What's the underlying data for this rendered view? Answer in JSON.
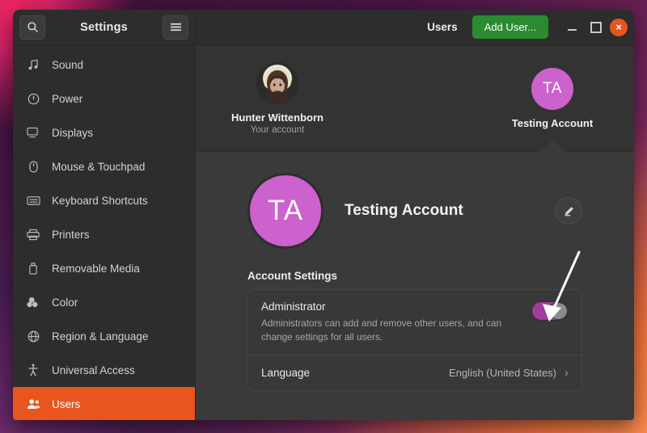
{
  "window": {
    "title": "Settings",
    "page_title": "Users",
    "add_user_label": "Add User...",
    "search_icon": "search-icon",
    "menu_icon": "hamburger-menu-icon",
    "minimize_label": "",
    "maximize_label": "",
    "close_label": "×",
    "accent_orange": "#e8551e",
    "accent_green": "#2a8c2f",
    "accent_purple": "#cd61cd"
  },
  "sidebar": {
    "items": [
      {
        "label": "Sound",
        "icon": "music-note-icon",
        "active": false
      },
      {
        "label": "Power",
        "icon": "power-icon",
        "active": false
      },
      {
        "label": "Displays",
        "icon": "monitor-icon",
        "active": false
      },
      {
        "label": "Mouse & Touchpad",
        "icon": "mouse-icon",
        "active": false
      },
      {
        "label": "Keyboard Shortcuts",
        "icon": "keyboard-icon",
        "active": false
      },
      {
        "label": "Printers",
        "icon": "printer-icon",
        "active": false
      },
      {
        "label": "Removable Media",
        "icon": "usb-drive-icon",
        "active": false
      },
      {
        "label": "Color",
        "icon": "color-palette-icon",
        "active": false
      },
      {
        "label": "Region & Language",
        "icon": "globe-icon",
        "active": false
      },
      {
        "label": "Universal Access",
        "icon": "accessibility-icon",
        "active": false
      },
      {
        "label": "Users",
        "icon": "users-icon",
        "active": true
      }
    ]
  },
  "carousel": {
    "accounts": [
      {
        "name": "Hunter Wittenborn",
        "subtitle": "Your account",
        "avatar_type": "photo",
        "initials": "",
        "selected": false
      },
      {
        "name": "Testing Account",
        "subtitle": "",
        "avatar_type": "initials",
        "initials": "TA",
        "selected": true
      }
    ]
  },
  "account_panel": {
    "initials": "TA",
    "name": "Testing Account",
    "edit_icon": "pencil-edit-icon",
    "section_title": "Account Settings",
    "rows": [
      {
        "title": "Administrator",
        "description": "Administrators can add and remove other users, and can change settings for all users.",
        "control": "toggle",
        "toggle_on": true
      },
      {
        "title": "Language",
        "value": "English (United States)",
        "control": "chevron",
        "chevron": "›"
      }
    ]
  },
  "annotation": {
    "type": "arrow",
    "points_to": "administrator-toggle",
    "color": "#ffffff"
  }
}
